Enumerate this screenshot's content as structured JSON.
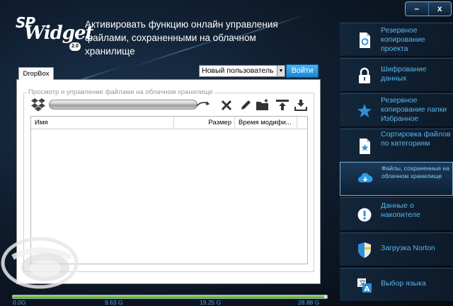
{
  "app": {
    "logo": {
      "sp": "SP",
      "widget": "Widget",
      "version": "2.0"
    },
    "title": "Активировать функцию онлайн управления файлами, сохраненными на облачном хранилище"
  },
  "window_controls": {
    "minimize": "–",
    "close": "x"
  },
  "sidebar": {
    "items": [
      {
        "label": "Резервное копирование проекта",
        "icon": "backup-project-icon",
        "active": false
      },
      {
        "label": "Шифрование данных",
        "icon": "lock-icon",
        "active": false
      },
      {
        "label": "Резервное копирование папки Избранное",
        "icon": "favorites-star-icon",
        "active": false
      },
      {
        "label": "Сортировка файлов по категориям",
        "icon": "sort-files-icon",
        "active": false
      },
      {
        "label": "Файлы, сохраненные на облачном хранилище",
        "icon": "cloud-icon",
        "active": true
      },
      {
        "label": "Данные о накопителе",
        "icon": "info-icon",
        "active": false
      },
      {
        "label": "Загрузка  Norton",
        "icon": "norton-shield-icon",
        "active": false
      },
      {
        "label": "Выбор языка",
        "icon": "language-icon",
        "active": false
      }
    ]
  },
  "main": {
    "tab": "DropBox",
    "user_select": {
      "value": "Новый пользователь"
    },
    "login_button": "Войти",
    "group_title": "Просмотр и управление файлами на облачном хранилище",
    "toolbar": [
      "delete-icon",
      "edit-icon",
      "new-folder-icon",
      "upload-icon",
      "download-icon"
    ],
    "table": {
      "columns": [
        "Имя",
        "Размер",
        "Время модифи..."
      ],
      "rows": []
    }
  },
  "capacity": {
    "fill_fraction": 0.99,
    "scale": [
      "0.0G",
      "9.63 G",
      "19.25 G",
      "28.88 G"
    ]
  },
  "colors": {
    "accent_blue": "#58b6ee",
    "login_button": "#1e8fde",
    "capacity_fill": "#5bbf30"
  }
}
